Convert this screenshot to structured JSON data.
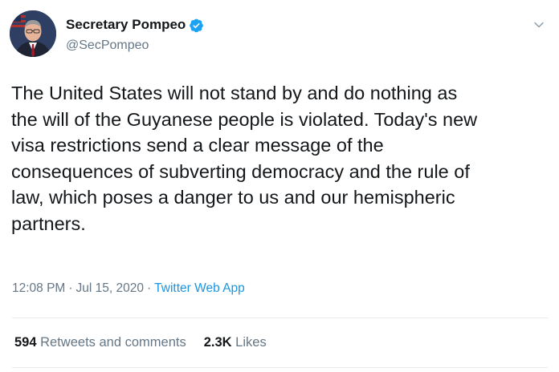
{
  "author": {
    "display_name": "Secretary Pompeo",
    "handle": "@SecPompeo",
    "verified": true,
    "verified_color": "#1da1f2"
  },
  "tweet": {
    "text": "The United States will not stand by and do nothing as\nthe will of the Guyanese people is violated. Today's new\nvisa restrictions send a clear message of the\nconsequences of subverting democracy and the rule of\nlaw, which poses a danger to us and our hemispheric\npartners.",
    "time": "12:08 PM",
    "separator": "·",
    "date": "Jul 15, 2020",
    "source": "Twitter Web App"
  },
  "stats": {
    "retweets_count": "594",
    "retweets_label": "Retweets and comments",
    "likes_count": "2.3K",
    "likes_label": "Likes"
  },
  "icons": {
    "verified": "verified-badge-icon",
    "menu": "chevron-down-icon"
  },
  "colors": {
    "text": "#14171a",
    "secondary": "#657786",
    "link": "#1b95e0"
  }
}
